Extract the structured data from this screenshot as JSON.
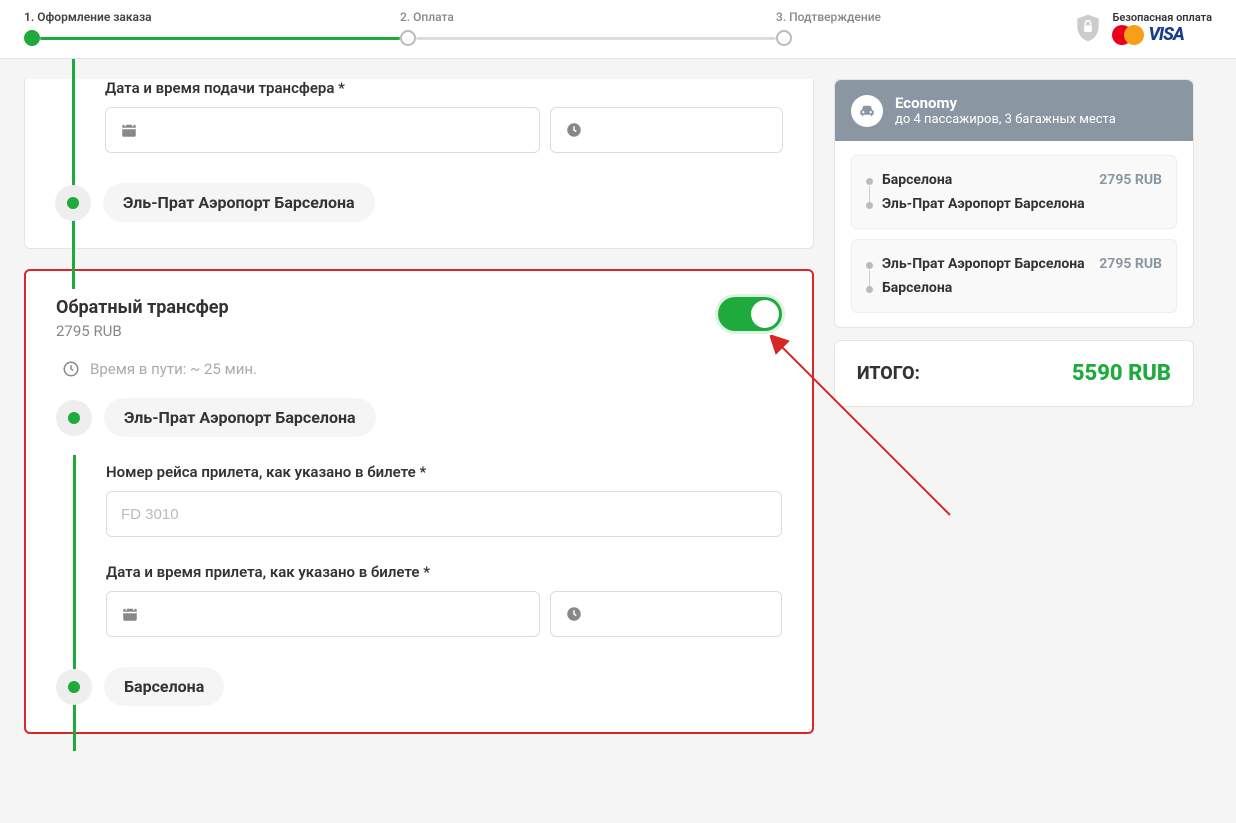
{
  "steps": {
    "s1": "1. Оформление заказа",
    "s2": "2. Оплата",
    "s3": "3. Подтверждение"
  },
  "secure_label": "Безопасная оплата",
  "visa_label": "VISA",
  "form1": {
    "date_label": "Дата и время подачи трансфера *",
    "dest": "Эль-Прат Аэропорт Барселона"
  },
  "return": {
    "title": "Обратный трансфер",
    "price": "2795 RUB",
    "travel_time": "Время в пути: ~ 25 мин.",
    "origin": "Эль-Прат Аэропорт Барселона",
    "flight_label": "Номер рейса прилета, как указано в билете *",
    "flight_placeholder": "FD 3010",
    "arrival_label": "Дата и время прилета, как указано в билете *",
    "dest": "Барселона"
  },
  "summary": {
    "class": "Economy",
    "class_sub": "до 4 пассажиров, 3 багажных места",
    "route1": {
      "from": "Барселона",
      "to": "Эль-Прат Аэропорт Барселона",
      "price": "2795 RUB"
    },
    "route2": {
      "from": "Эль-Прат Аэропорт Барселона",
      "to": "Барселона",
      "price": "2795 RUB"
    }
  },
  "total": {
    "label": "ИТОГО:",
    "value": "5590 RUB"
  }
}
